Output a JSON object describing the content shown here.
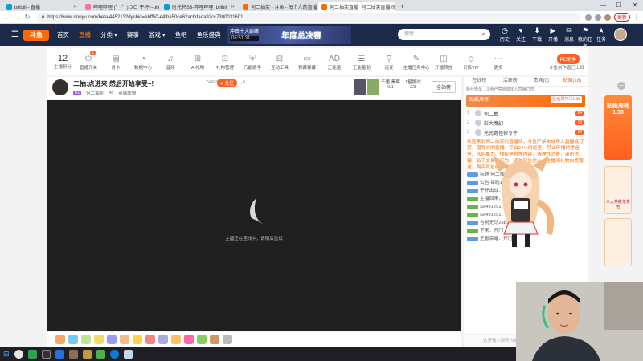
{
  "browser": {
    "tabs": [
      {
        "title": "bilibili - 直播",
        "color": "#00a1d6"
      },
      {
        "title": "哔哩哔哩 (゜-゜)つロ 干杯~-bilibili",
        "color": "#fb7299"
      },
      {
        "title": "时光杯S3-哔哩哔哩_bilibili",
        "color": "#00a1d6"
      },
      {
        "title": "何二抽奖 - 斗鱼 - 每个人的直播平台",
        "color": "#ff6a00"
      },
      {
        "title": "何二抽奖直播_何二抽奖直播间_何二",
        "color": "#ff6a00"
      }
    ],
    "url": "https://www.douyu.com/beta/445213?dyshid=ebff50-e4fba50ce62acbdada92cc7300031601",
    "update_label": "更新",
    "new_tab": "+",
    "win_min": "—",
    "win_max": "☐",
    "win_close": "✕"
  },
  "header": {
    "logo": "斗鱼",
    "nav": [
      "首页",
      "直播",
      "分类",
      "赛事",
      "游戏",
      "鱼吧",
      "鱼乐盛典"
    ],
    "active_nav": "直播",
    "banner_line1": "冲击十大巅峰",
    "banner_line2": "06:51:31",
    "banner_title": "年度总决赛",
    "search_placeholder": "搜索",
    "icons": [
      {
        "name": "history",
        "label": "历史",
        "glyph": "◷"
      },
      {
        "name": "follow",
        "label": "关注",
        "glyph": "♥"
      },
      {
        "name": "download",
        "label": "下载",
        "glyph": "⬇"
      },
      {
        "name": "live",
        "label": "开播",
        "glyph": "▶"
      },
      {
        "name": "messages",
        "label": "消息",
        "glyph": "✉"
      },
      {
        "name": "my-tasks",
        "label": "我的任务",
        "glyph": "⚑"
      },
      {
        "name": "tasks",
        "label": "任务",
        "glyph": "★"
      }
    ]
  },
  "toolstrip": {
    "level_number": "12",
    "level_label": "主播积分",
    "tools": [
      {
        "label": "直播开关",
        "glyph": "⏻",
        "badge": "1"
      },
      {
        "label": "月卡",
        "glyph": "▤"
      },
      {
        "label": "数据中心",
        "glyph": "◔"
      },
      {
        "label": "音频",
        "glyph": "♫"
      },
      {
        "label": "AI礼物",
        "glyph": "⊞"
      },
      {
        "label": "礼物管理",
        "glyph": "⊡"
      },
      {
        "label": "万能助手",
        "glyph": "⛨"
      },
      {
        "label": "互动工具",
        "glyph": "⊟"
      },
      {
        "label": "弹幕弹幕",
        "glyph": "▭"
      },
      {
        "label": "正能量",
        "glyph": "AD"
      },
      {
        "label": "正能量助",
        "glyph": "☰"
      },
      {
        "label": "连麦",
        "glyph": "⚲"
      },
      {
        "label": "主播任务中心",
        "glyph": "✎"
      },
      {
        "label": "开播预告",
        "glyph": "◫"
      },
      {
        "label": "贵族VIP",
        "glyph": "◇"
      },
      {
        "label": "更多",
        "glyph": "⋯"
      }
    ],
    "pc_button": "PC助手",
    "pc_sub": "斗鱼创作者已上线"
  },
  "room": {
    "title": "二抽:点进来 然后开始享受~!",
    "level": "61",
    "anchor_name": "何二抽奖",
    "heat": "48",
    "category": "英雄联盟",
    "fans": "74498",
    "follow_label": "关注",
    "pk_label": "千里·黑莓",
    "pk_score": "0/1",
    "rank_label": "1星挑战",
    "rank_score": "2/3",
    "full_station": "全站榜",
    "player_message": "主播正在连线中，请稍后重试"
  },
  "sidebar": {
    "tabs": [
      "在线榜",
      "活跃榜",
      "贵宾(0)",
      "贴图(18)"
    ],
    "active_tab": "贴图(18)",
    "notice": "粉丝榜单 · 斗鱼严禁未成年人直播打赏",
    "rank_card": "贴纸周榜",
    "rank_card_tag": "贴纸周排行1.38",
    "rank_rows": [
      {
        "no": "1",
        "name": "何二抽",
        "score": "24"
      },
      {
        "no": "2",
        "name": "彩大魔幻",
        "score": "18"
      },
      {
        "no": "3",
        "name": "光亮奇怪修专牛",
        "score": "14"
      }
    ],
    "system_msg": "欢迎来到何二抽奖的直播间，斗鱼严禁未成年人直播或打赏。倡导文明直播，平台24小时巡查，禁止传播封建迷信、低俗暴力、侵权信息等内容，请理性消费，谨防诈骗，私下交易等行为，请勿轻信他人，主播间礼物自愿赠送，购买礼包前请确认。",
    "chat_lines": [
      {
        "badge": "blue",
        "text": "标题  何二抽奖：开门"
      },
      {
        "badge": "blue",
        "text": "公告  每晚11点开奖"
      },
      {
        "badge": "blue",
        "text": "干杯出战：开门"
      },
      {
        "badge": "green",
        "text": "主播回来，ob"
      },
      {
        "badge": "green",
        "text": "Sa491291：战斗呢？"
      },
      {
        "badge": "green",
        "text": "Sa491291：战斗呢？"
      },
      {
        "badge": "blue",
        "text": "告别无尽2381：开门"
      },
      {
        "badge": "green",
        "text": "下来：开门"
      },
      {
        "badge": "blue",
        "text": "王者荣耀：开门"
      }
    ],
    "input_placeholder": "这里输入聊天内容"
  },
  "ads": {
    "top": "贴纸周榜1.38",
    "mid": "八大英雄年货节"
  },
  "taskbar": {
    "start": "⊞"
  }
}
